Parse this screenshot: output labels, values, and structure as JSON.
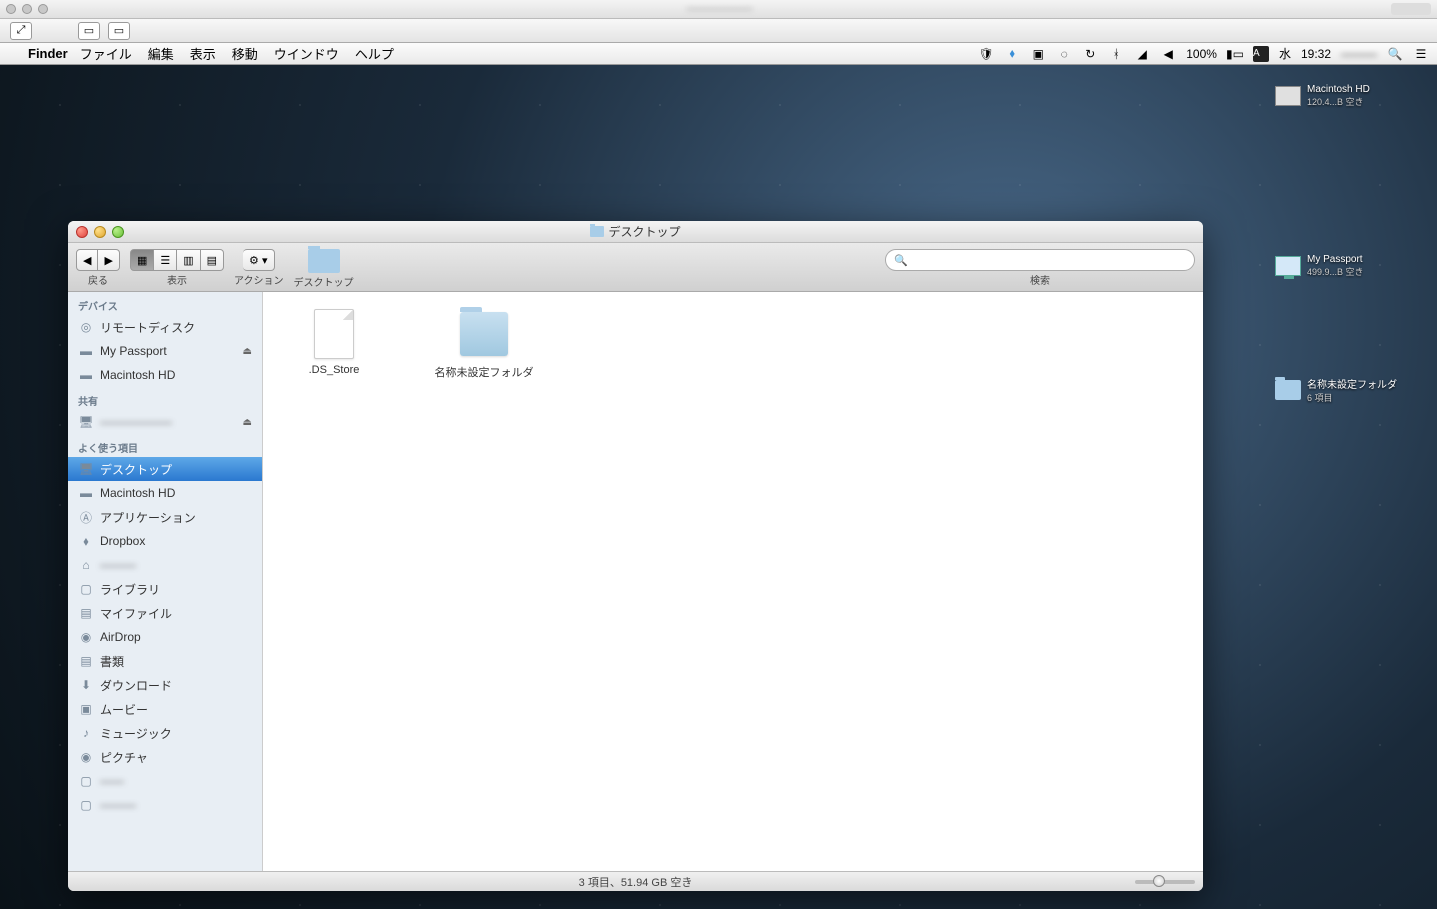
{
  "menubar": {
    "app": "Finder",
    "items": [
      "ファイル",
      "編集",
      "表示",
      "移動",
      "ウインドウ",
      "ヘルプ"
    ],
    "battery": "100%",
    "day": "水",
    "time": "19:32",
    "input_badge": "A"
  },
  "desktop_icons": [
    {
      "name": "Macintosh HD",
      "sub": "120.4...B 空き",
      "type": "hd"
    },
    {
      "name": "My Passport",
      "sub": "499.9...B 空き",
      "type": "ext"
    },
    {
      "name": "名称未設定フォルダ",
      "sub": "6 項目",
      "type": "folder"
    }
  ],
  "finder": {
    "title": "デスクトップ",
    "toolbar": {
      "back_label": "戻る",
      "view_label": "表示",
      "action_label": "アクション",
      "path_label": "デスクトップ",
      "search_label": "検索",
      "search_placeholder": ""
    },
    "sidebar": {
      "devices_header": "デバイス",
      "devices": [
        {
          "label": "リモートディスク",
          "icon": "disc"
        },
        {
          "label": "My Passport",
          "icon": "hd",
          "eject": true
        },
        {
          "label": "Macintosh HD",
          "icon": "hd"
        }
      ],
      "shared_header": "共有",
      "shared": [
        {
          "label": "——————",
          "icon": "pc",
          "eject": true,
          "blur": true
        }
      ],
      "favorites_header": "よく使う項目",
      "favorites": [
        {
          "label": "デスクトップ",
          "icon": "desktop",
          "selected": true
        },
        {
          "label": "Macintosh HD",
          "icon": "hd"
        },
        {
          "label": "アプリケーション",
          "icon": "apps"
        },
        {
          "label": "Dropbox",
          "icon": "dropbox"
        },
        {
          "label": "———",
          "icon": "home",
          "blur": true
        },
        {
          "label": "ライブラリ",
          "icon": "folder"
        },
        {
          "label": "マイファイル",
          "icon": "allfiles"
        },
        {
          "label": "AirDrop",
          "icon": "airdrop"
        },
        {
          "label": "書類",
          "icon": "docs"
        },
        {
          "label": "ダウンロード",
          "icon": "downloads"
        },
        {
          "label": "ムービー",
          "icon": "movies"
        },
        {
          "label": "ミュージック",
          "icon": "music"
        },
        {
          "label": "ピクチャ",
          "icon": "pictures"
        },
        {
          "label": "——",
          "icon": "folder",
          "blur": true
        },
        {
          "label": "———",
          "icon": "folder",
          "blur": true
        }
      ]
    },
    "items": [
      {
        "label": ".DS_Store",
        "type": "file"
      },
      {
        "label": "名称未設定フォルダ",
        "type": "folder"
      }
    ],
    "status": "3 項目、51.94 GB 空き"
  }
}
